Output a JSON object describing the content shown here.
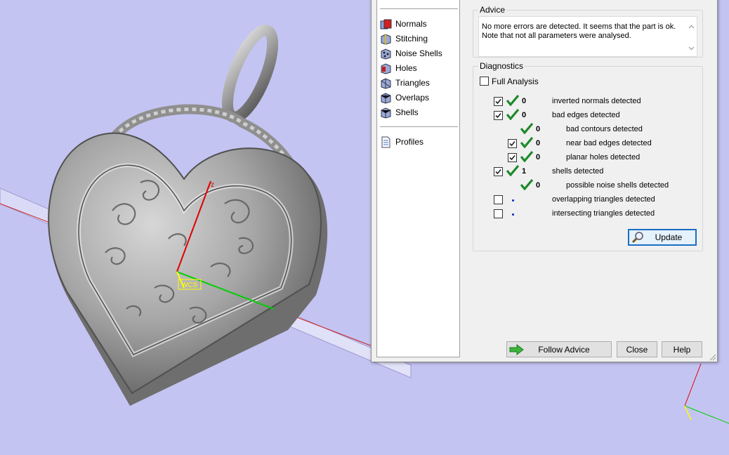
{
  "sidebar": {
    "items": [
      {
        "label": "Normals",
        "icon": "normals-icon"
      },
      {
        "label": "Stitching",
        "icon": "stitching-icon"
      },
      {
        "label": "Noise Shells",
        "icon": "noise-shells-icon"
      },
      {
        "label": "Holes",
        "icon": "holes-icon"
      },
      {
        "label": "Triangles",
        "icon": "triangles-icon"
      },
      {
        "label": "Overlaps",
        "icon": "overlaps-icon"
      },
      {
        "label": "Shells",
        "icon": "shells-icon"
      }
    ],
    "profiles": {
      "label": "Profiles",
      "icon": "profiles-icon"
    }
  },
  "advice": {
    "title": "Advice",
    "line1": "No more errors are detected. It seems that the part is ok.",
    "line2": "Note that not all parameters were analysed."
  },
  "diagnostics": {
    "title": "Diagnostics",
    "full_analysis": {
      "label": "Full Analysis",
      "checked": false
    },
    "rows": [
      {
        "label": "inverted normals detected",
        "count": "0",
        "checked": true,
        "status": "ok"
      },
      {
        "label": "bad edges detected",
        "count": "0",
        "checked": true,
        "status": "ok"
      },
      {
        "label": "bad contours detected",
        "count": "0",
        "status": "ok"
      },
      {
        "label": "near bad edges detected",
        "count": "0",
        "checked": true,
        "status": "ok"
      },
      {
        "label": "planar holes detected",
        "count": "0",
        "checked": true,
        "status": "ok"
      },
      {
        "label": "shells detected",
        "count": "1",
        "checked": true,
        "status": "ok"
      },
      {
        "label": "possible noise shells detected",
        "count": "0",
        "status": "ok"
      },
      {
        "label": "overlapping triangles detected",
        "count": "",
        "checked": false,
        "status": "not-analysed"
      },
      {
        "label": "intersecting triangles detected",
        "count": "",
        "checked": false,
        "status": "not-analysed"
      }
    ],
    "update_label": "Update"
  },
  "buttons": {
    "follow_advice": "Follow Advice",
    "close": "Close",
    "help": "Help"
  },
  "viewport": {
    "gizmo_label": "WCS",
    "colors": {
      "background": "#c4c4f2",
      "x_axis": "#00d000",
      "y_axis": "#ffff00",
      "z_axis": "#e00000",
      "check": "#1e8a2a"
    }
  }
}
